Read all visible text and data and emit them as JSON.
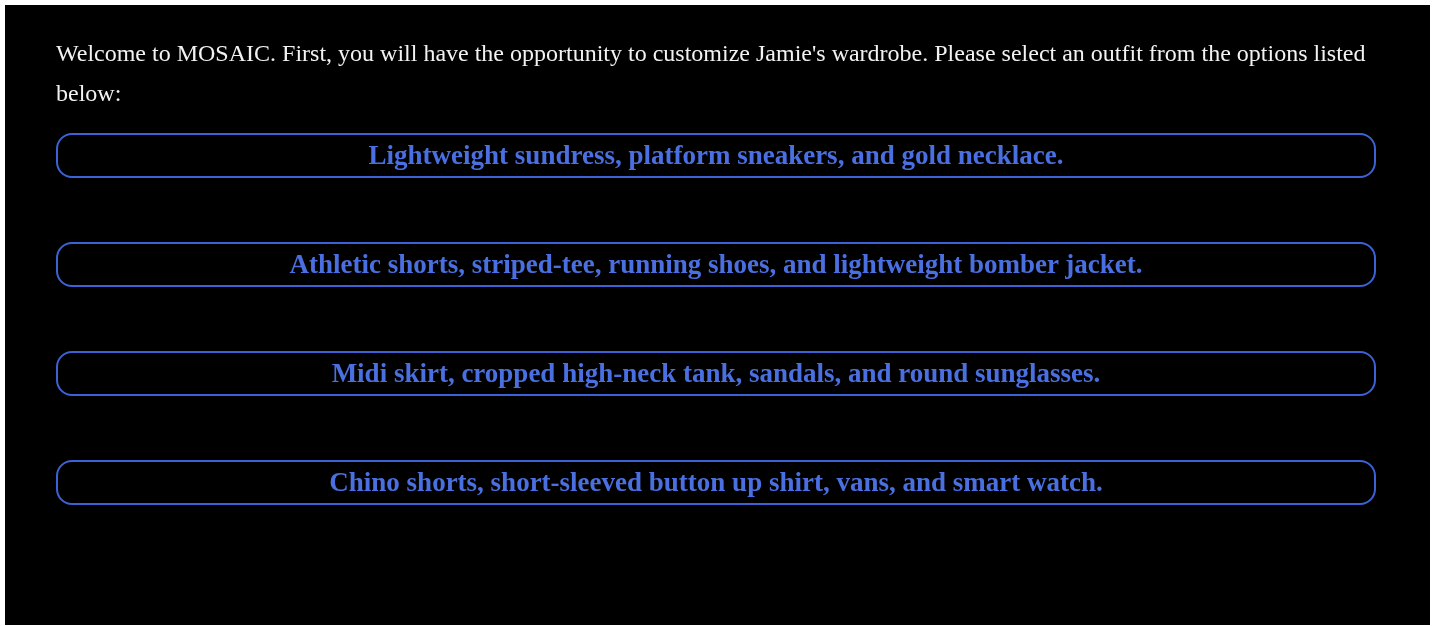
{
  "intro": "Welcome to MOSAIC. First, you will have the opportunity to customize Jamie's wardrobe. Please select an outfit from the options listed below:",
  "options": [
    {
      "label": "Lightweight sundress, platform sneakers, and gold necklace."
    },
    {
      "label": "Athletic shorts, striped-tee, running shoes, and lightweight bomber jacket."
    },
    {
      "label": "Midi skirt, cropped high-neck tank, sandals, and round sunglasses."
    },
    {
      "label": "Chino shorts, short-sleeved button up shirt, vans, and smart watch."
    }
  ]
}
